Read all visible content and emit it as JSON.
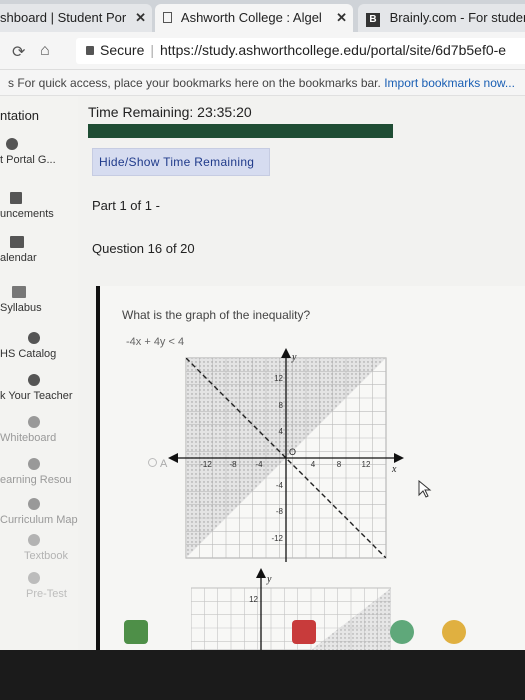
{
  "browser": {
    "tabs": [
      {
        "label": "shboard | Student Por"
      },
      {
        "label": "Ashworth College : Algel"
      },
      {
        "label": "Brainly.com - For studen",
        "badge": "B"
      }
    ],
    "secure_label": "Secure",
    "url": "https://study.ashworthcollege.edu/portal/site/6d7b5ef0-e",
    "bookmarks_text": "s  For quick access, place your bookmarks here on the bookmarks bar.",
    "bookmarks_link": "Import bookmarks now..."
  },
  "sidebar": {
    "header": "ntation",
    "items": [
      {
        "label": "t Portal G...",
        "icon": "portal-icon"
      },
      {
        "label": "uncements",
        "icon": "megaphone-icon"
      },
      {
        "label": "alendar",
        "icon": "calendar-icon"
      },
      {
        "label": "Syllabus",
        "icon": "book-icon"
      },
      {
        "label": "HS Catalog",
        "icon": "catalog-icon"
      },
      {
        "label": "k Your Teacher",
        "icon": "chat-icon"
      },
      {
        "label": "Whiteboard",
        "icon": "whiteboard-icon"
      },
      {
        "label": "earning Resou",
        "icon": "resources-icon"
      },
      {
        "label": "Curriculum Map",
        "icon": "map-icon"
      },
      {
        "label": "Textbook",
        "icon": "textbook-icon"
      },
      {
        "label": "Pre-Test",
        "icon": "pretest-icon"
      }
    ]
  },
  "quiz": {
    "time_label": "Time Remaining: 23:35:20",
    "progress": 1.0,
    "hide_button": "Hide/Show Time Remaining",
    "part": "Part 1 of 1 -",
    "question_number": "Question 16 of 20",
    "question_text": "What is the graph of the inequality?",
    "inequality": "-4x + 4y < 4",
    "option_a": "A",
    "graph": {
      "x_label": "x",
      "y_label": "y",
      "origin_label": "O",
      "x_ticks": [
        "-12",
        "-8",
        "-4",
        "4",
        "8",
        "12"
      ],
      "y_ticks": [
        "12",
        "8",
        "4",
        "-4",
        "-8",
        "-12"
      ],
      "y_ticks_second": [
        "12"
      ]
    }
  },
  "colors": {
    "progress_fill": "#1f4d34",
    "button_bg": "#d6dcf0",
    "button_text": "#1f3a8a"
  }
}
